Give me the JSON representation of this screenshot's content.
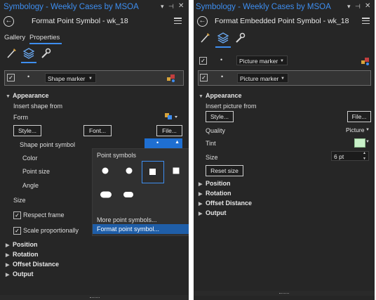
{
  "left": {
    "window_title": "Symbology - Weekly Cases by MSOA",
    "subtitle": "Format Point Symbol - wk_18",
    "tabs": [
      "Gallery",
      "Properties"
    ],
    "layer_row": {
      "dot": "•",
      "dropdown": "Shape marker"
    },
    "appearance": {
      "header": "Appearance",
      "insert_label": "Insert shape from",
      "form_label": "Form",
      "style_btn": "Style...",
      "font_btn": "Font...",
      "file_btn": "File...",
      "shape_label": "Shape point symbol",
      "shape_value": "•",
      "color_label": "Color",
      "point_size_label": "Point size",
      "angle_label": "Angle"
    },
    "size_label": "Size",
    "respect_frame_label": "Respect frame",
    "scale_prop_label": "Scale proportionally",
    "popup": {
      "title": "Point symbols",
      "more": "More point symbols...",
      "format": "Format point symbol..."
    },
    "sections": [
      "Position",
      "Rotation",
      "Offset Distance",
      "Output"
    ]
  },
  "right": {
    "window_title": "Symbology - Weekly Cases by MSOA",
    "subtitle": "Format Embedded Point Symbol - wk_18",
    "rows": [
      {
        "dot": "•",
        "dropdown": "Picture marker"
      },
      {
        "dot": "•",
        "dropdown": "Picture marker"
      }
    ],
    "appearance": {
      "header": "Appearance",
      "insert_label": "Insert picture from",
      "style_btn": "Style...",
      "file_btn": "File...",
      "quality_label": "Quality",
      "quality_value": "Picture",
      "tint_label": "Tint",
      "size_label": "Size",
      "size_value": "6 pt",
      "reset_btn": "Reset size"
    },
    "sections": [
      "Position",
      "Rotation",
      "Offset Distance",
      "Output"
    ]
  },
  "colors": {
    "accent": "#3e8ef0",
    "panel": "#262626",
    "highlight": "#1f6fd1"
  }
}
